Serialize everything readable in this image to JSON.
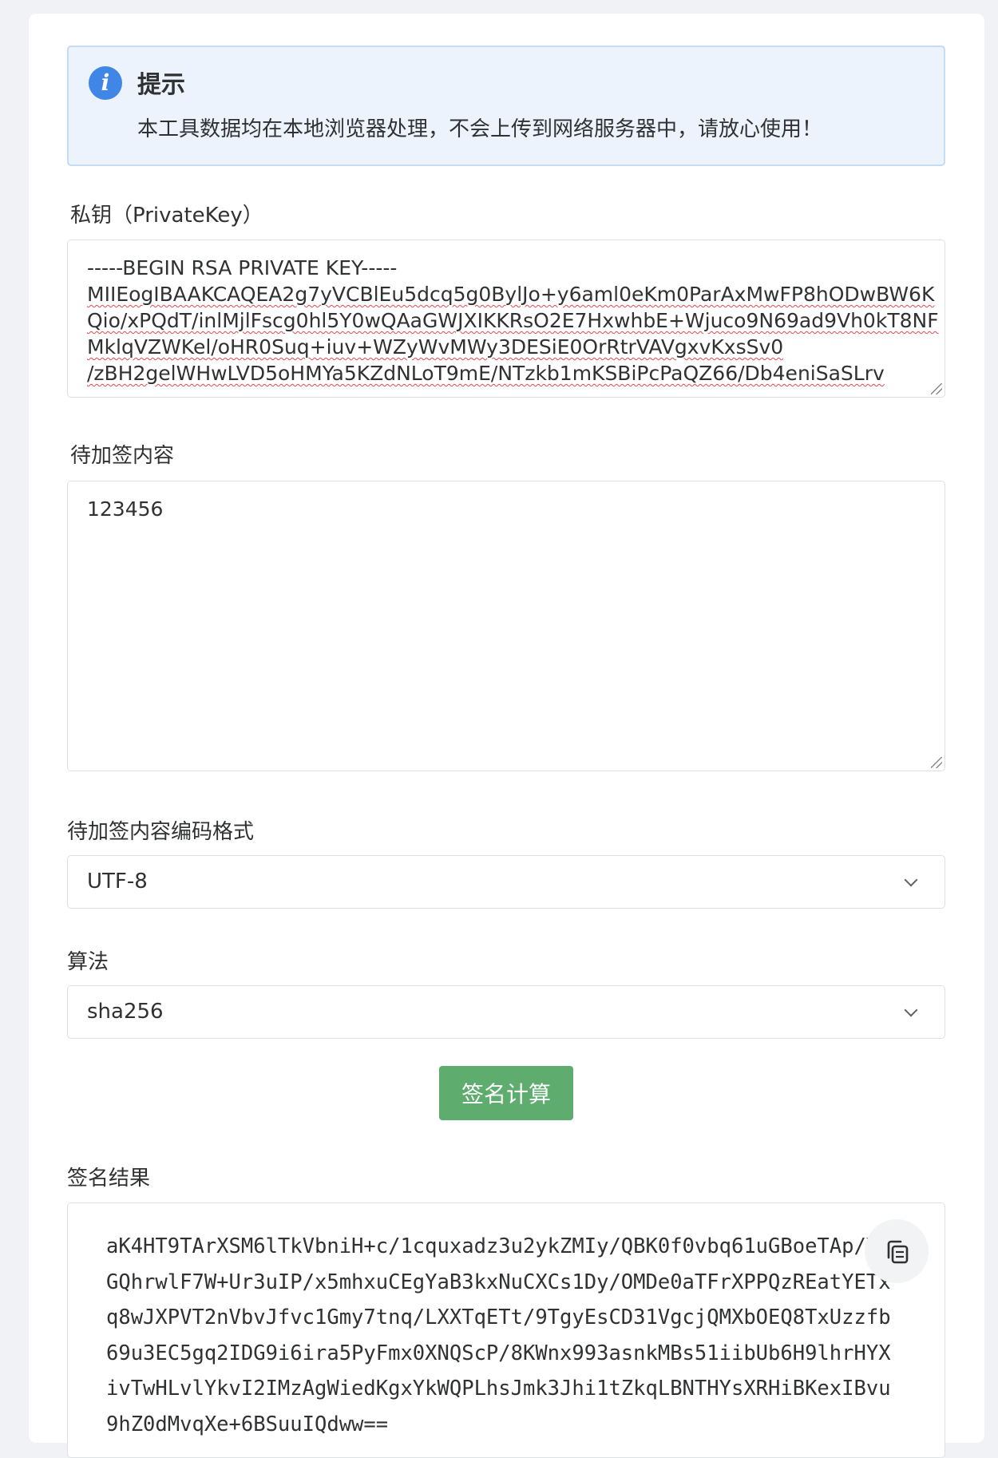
{
  "tip": {
    "title": "提示",
    "text": "本工具数据均在本地浏览器处理，不会上传到网络服务器中，请放心使用！"
  },
  "private_key": {
    "label": "私钥（PrivateKey）",
    "header": "-----BEGIN RSA PRIVATE KEY-----",
    "body": "MIIEogIBAAKCAQEA2g7yVCBlEu5dcq5g0BylJo+y6aml0eKm0ParAxMwFP8hODwBW6KQio/xPQdT/inlMjlFscg0hl5Y0wQAaGWJXIKKRsO2E7HxwhbE+Wjuco9N69ad9Vh0kT8NFMklqVZWKel/oHR0Suq+iuv+WZyWvMWy3DESiE0OrRtrVAVgxvKxsSv0",
    "partial_line": "/zBH2gelWHwLVD5oHMYa5KZdNLoT9mE/NTzkb1mKSBiPcPaQZ66/Db4eniSaSLrv"
  },
  "content": {
    "label": "待加签内容",
    "value": "123456"
  },
  "encoding": {
    "label": "待加签内容编码格式",
    "selected": "UTF-8"
  },
  "algorithm": {
    "label": "算法",
    "selected": "sha256"
  },
  "actions": {
    "sign_label": "签名计算"
  },
  "result": {
    "label": "签名结果",
    "value": "aK4HT9TArXSM6lTkVbniH+c/1cquxadz3u2ykZMIy/QBK0f0vbq61uGBoeTAp/Y2GQhrwlF7W+Ur3uIP/x5mhxuCEgYaB3kxNuCXCs1Dy/OMDe0aTFrXPPQzREatYETxq8wJXPVT2nVbvJfvc1Gmy7tnq/LXXTqETt/9TgyEsCD31VgcjQMXbOEQ8TxUzzfb69u3EC5gq2IDG9i6ira5PyFmx0XNQScP/8KWnx993asnkMBs51iibUb6H9lhrHYXivTwHLvlYkvI2IMzAgWiedKgxYkWQPLhsJmk3Jhi1tZkqLBNTHYsXRHiBKexIBvu9hZ0dMvqXe+6BSuuIQdww=="
  },
  "colors": {
    "info_icon": "#3f86e6",
    "tip_background": "#ecf3fc",
    "sign_button": "#5fad6e",
    "spellcheck_underline": "#e5484d"
  }
}
